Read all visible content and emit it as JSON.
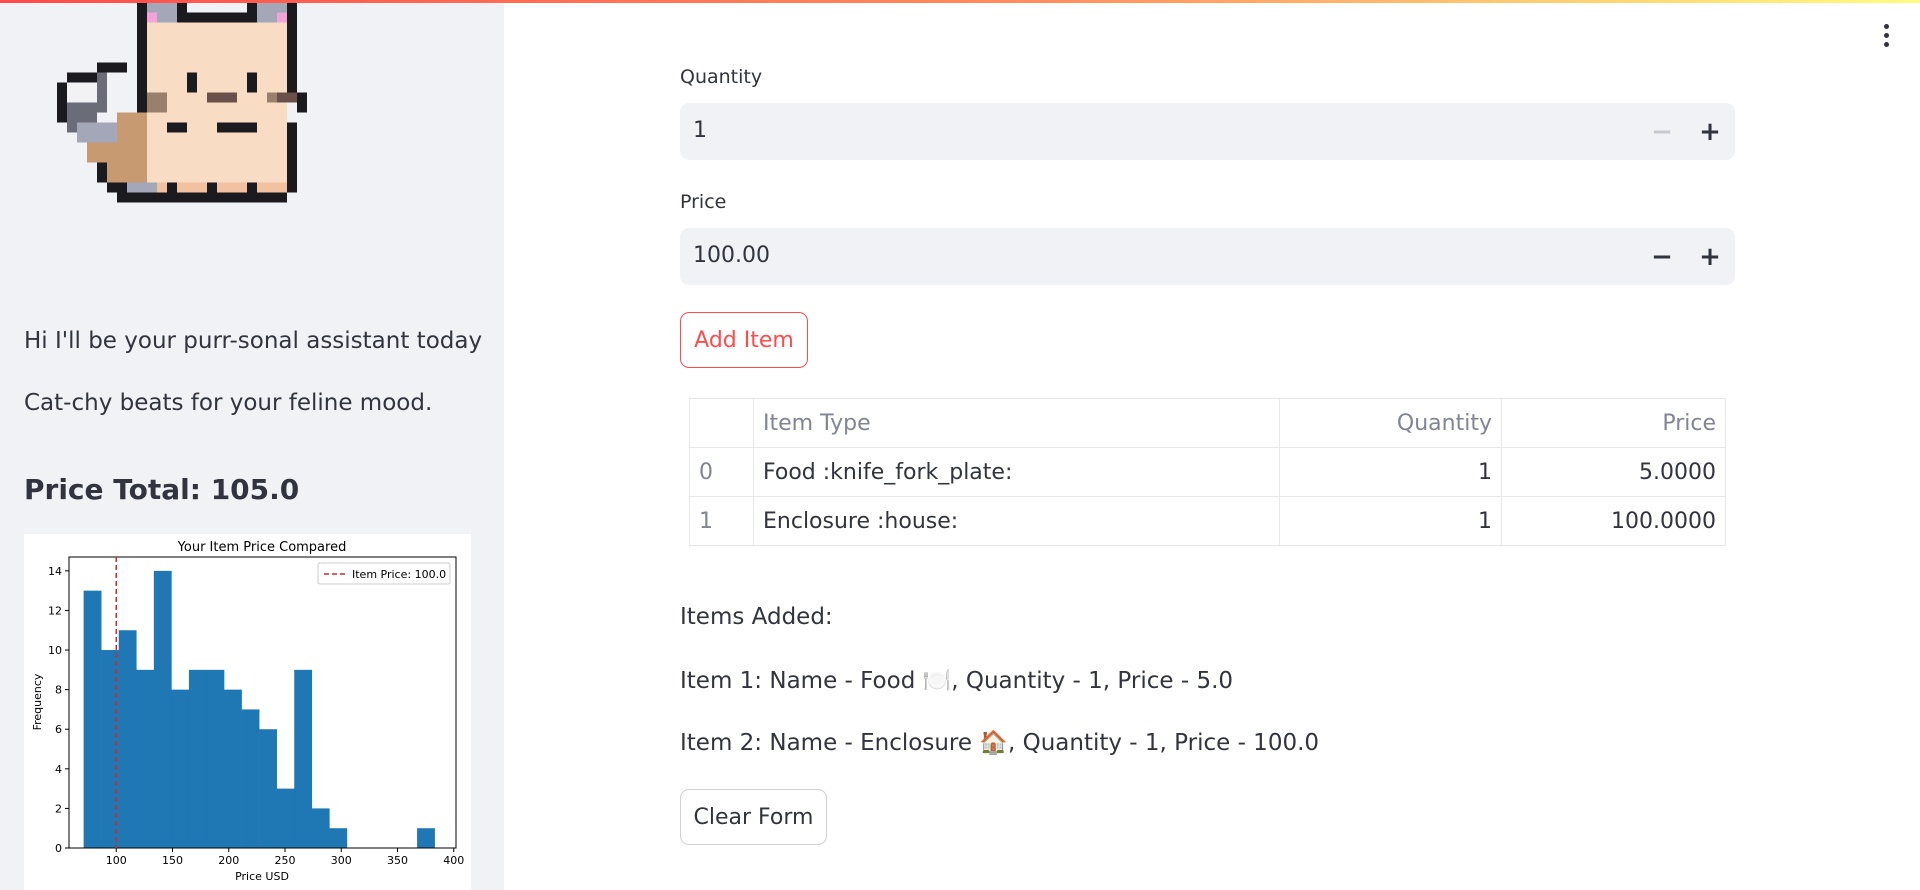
{
  "sidebar": {
    "greeting": "Hi I'll be your purr-sonal assistant today",
    "tagline": "Cat-chy beats for your feline mood.",
    "price_total": "Price Total: 105.0"
  },
  "chart_data": {
    "type": "bar",
    "title": "Your Item Price Compared",
    "xlabel": "Price USD",
    "ylabel": "Frequency",
    "xlim": [
      58,
      402
    ],
    "ylim": [
      0,
      14.7
    ],
    "xticks": [
      100,
      150,
      200,
      250,
      300,
      350,
      400
    ],
    "yticks": [
      0,
      2,
      4,
      6,
      8,
      10,
      12,
      14
    ],
    "bin_width": 15.6,
    "bins": [
      {
        "x0": 71.0,
        "value": 13
      },
      {
        "x0": 86.6,
        "value": 10
      },
      {
        "x0": 102.2,
        "value": 11
      },
      {
        "x0": 117.8,
        "value": 9
      },
      {
        "x0": 133.4,
        "value": 14
      },
      {
        "x0": 149.0,
        "value": 8
      },
      {
        "x0": 164.6,
        "value": 9
      },
      {
        "x0": 180.2,
        "value": 9
      },
      {
        "x0": 195.8,
        "value": 8
      },
      {
        "x0": 211.4,
        "value": 7
      },
      {
        "x0": 227.0,
        "value": 6
      },
      {
        "x0": 242.6,
        "value": 3
      },
      {
        "x0": 258.2,
        "value": 9
      },
      {
        "x0": 273.8,
        "value": 2
      },
      {
        "x0": 289.4,
        "value": 1
      },
      {
        "x0": 305.0,
        "value": 0
      },
      {
        "x0": 320.6,
        "value": 0
      },
      {
        "x0": 336.2,
        "value": 0
      },
      {
        "x0": 351.8,
        "value": 0
      },
      {
        "x0": 367.4,
        "value": 1
      }
    ],
    "reference_line": {
      "x": 100.0,
      "label": "Item Price: 100.0"
    },
    "legend": "top-right",
    "grid": false,
    "bar_color": "#1f77b4",
    "line_color": "#d62728"
  },
  "form": {
    "quantity_label": "Quantity",
    "quantity_value": "1",
    "price_label": "Price",
    "price_value": "100.00",
    "minus": "−",
    "plus": "+",
    "add_item_label": "Add Item",
    "clear_form_label": "Clear Form"
  },
  "table": {
    "columns": [
      "",
      "Item Type",
      "Quantity",
      "Price"
    ],
    "rows": [
      {
        "index": "0",
        "item_type": "Food :knife_fork_plate:",
        "quantity": "1",
        "price": "5.0000"
      },
      {
        "index": "1",
        "item_type": "Enclosure :house:",
        "quantity": "1",
        "price": "100.0000"
      }
    ]
  },
  "items_added": {
    "heading": "Items Added:",
    "lines": [
      "Item 1: Name - Food 🍽️, Quantity - 1, Price - 5.0",
      "Item 2: Name - Enclosure 🏠, Quantity - 1, Price - 100.0"
    ]
  },
  "colors": {
    "accent": "#ff4b4b",
    "sidebar_bg": "#f0f2f6",
    "input_bg": "#f0f2f6",
    "text": "#31333f"
  },
  "icons": {
    "mascot": "pixel-cat-icon",
    "menu": "kebab-menu-icon"
  }
}
